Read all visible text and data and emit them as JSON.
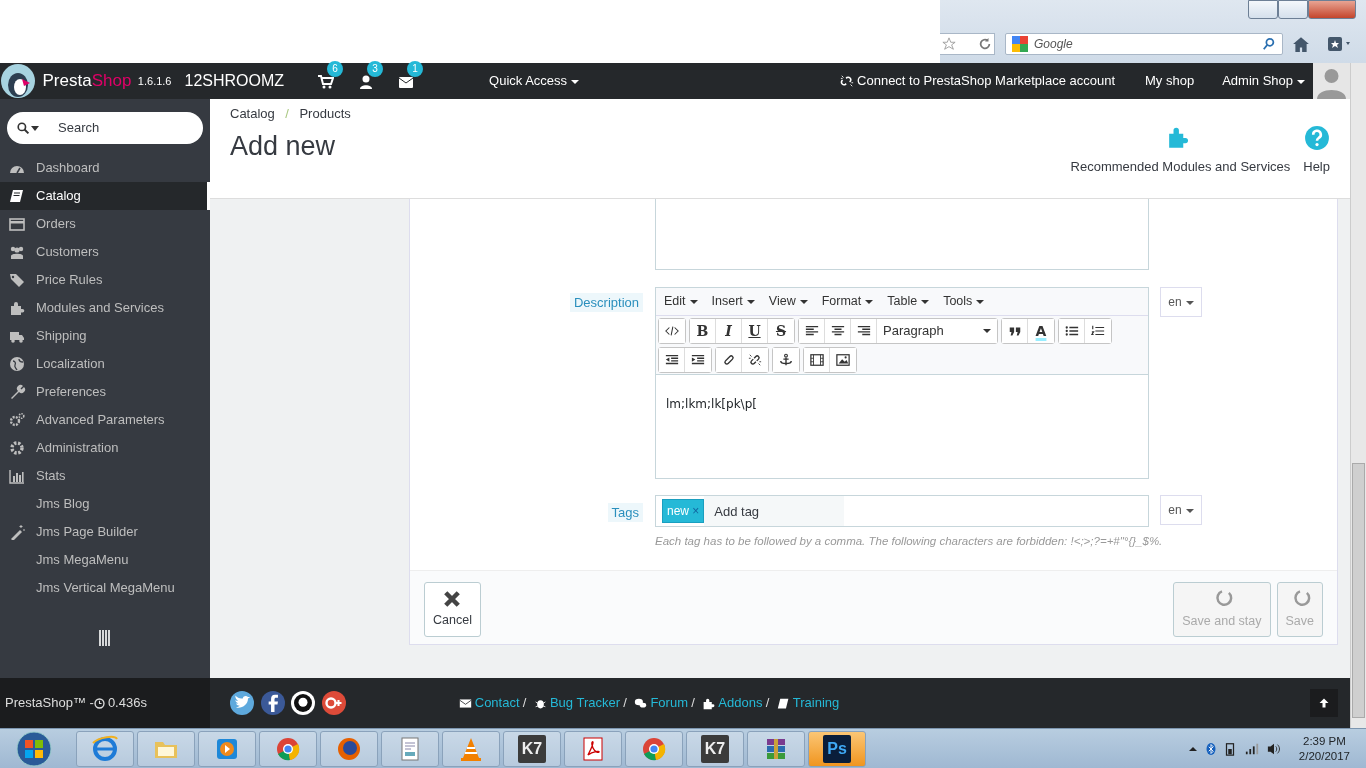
{
  "browser": {
    "search_placeholder": "Google"
  },
  "header": {
    "brand_first": "Presta",
    "brand_second": "Shop",
    "version": "1.6.1.6",
    "shop_name": "12SHROOMZ",
    "notifications": [
      {
        "kind": "cart",
        "count": "6"
      },
      {
        "kind": "user",
        "count": "3"
      },
      {
        "kind": "mail",
        "count": "1"
      }
    ],
    "quick_access": "Quick Access",
    "connect": "Connect to PrestaShop Marketplace account",
    "my_shop": "My shop",
    "admin": "Admin Shop"
  },
  "sidebar": {
    "search_placeholder": "Search",
    "items": [
      {
        "label": "Dashboard",
        "kind": "dashboard",
        "selected": false
      },
      {
        "label": "Catalog",
        "kind": "catalog",
        "selected": true
      },
      {
        "label": "Orders",
        "kind": "orders",
        "selected": false
      },
      {
        "label": "Customers",
        "kind": "customers",
        "selected": false
      },
      {
        "label": "Price Rules",
        "kind": "price",
        "selected": false
      },
      {
        "label": "Modules and Services",
        "kind": "modules",
        "selected": false
      },
      {
        "label": "Shipping",
        "kind": "shipping",
        "selected": false
      },
      {
        "label": "Localization",
        "kind": "localization",
        "selected": false
      },
      {
        "label": "Preferences",
        "kind": "preferences",
        "selected": false
      },
      {
        "label": "Advanced Parameters",
        "kind": "advanced",
        "selected": false
      },
      {
        "label": "Administration",
        "kind": "administration",
        "selected": false
      },
      {
        "label": "Stats",
        "kind": "stats",
        "selected": false
      },
      {
        "label": "Jms Blog",
        "kind": "none",
        "selected": false
      },
      {
        "label": "Jms Page Builder",
        "kind": "wand",
        "selected": false
      },
      {
        "label": "Jms MegaMenu",
        "kind": "none",
        "selected": false
      },
      {
        "label": "Jms Vertical MegaMenu",
        "kind": "none",
        "selected": false
      }
    ]
  },
  "page_head": {
    "breadcrumb": [
      "Catalog",
      "Products"
    ],
    "breadcrumb_separator": "/",
    "title": "Add new",
    "toolbar": [
      {
        "kind": "modules",
        "label": "Recommended Modules and Services"
      },
      {
        "kind": "help",
        "label": "Help"
      }
    ]
  },
  "form": {
    "description": {
      "label": "Description",
      "menus": [
        "Edit",
        "Insert",
        "View",
        "Format",
        "Table",
        "Tools"
      ],
      "toolbar_rows": [
        [
          [
            {
              "kind": "code"
            }
          ],
          [
            {
              "kind": "bold",
              "glyph": "B"
            },
            {
              "kind": "italic",
              "glyph": "I"
            },
            {
              "kind": "underline",
              "glyph": "U"
            },
            {
              "kind": "strike",
              "glyph": "S"
            }
          ],
          [
            {
              "kind": "alignleft"
            },
            {
              "kind": "aligncenter"
            },
            {
              "kind": "alignright"
            },
            {
              "kind": "select",
              "label": "Paragraph"
            }
          ],
          [
            {
              "kind": "quote"
            },
            {
              "kind": "color",
              "glyph": "A"
            }
          ],
          [
            {
              "kind": "bullist"
            },
            {
              "kind": "numlist"
            }
          ]
        ],
        [
          [
            {
              "kind": "outdent"
            },
            {
              "kind": "indent"
            }
          ],
          [
            {
              "kind": "link"
            },
            {
              "kind": "unlink"
            }
          ],
          [
            {
              "kind": "anchor"
            }
          ],
          [
            {
              "kind": "media"
            },
            {
              "kind": "image"
            }
          ]
        ]
      ],
      "content": "lm;lkm;lk[pk\\p[",
      "language": "en"
    },
    "tags": {
      "label": "Tags",
      "items": [
        {
          "label": "new",
          "remove": "×"
        }
      ],
      "placeholder": "Add tag",
      "language": "en",
      "hint": "Each tag has to be followed by a comma. The following characters are forbidden: !<;>;?=+#\"°{}_$%."
    },
    "buttons": [
      {
        "kind": "cancel",
        "label": "Cancel",
        "disabled": false
      },
      {
        "kind": "refresh",
        "label": "Save and stay",
        "disabled": true
      },
      {
        "kind": "refresh",
        "label": "Save",
        "disabled": true
      }
    ]
  },
  "footer": {
    "brand": "PrestaShop™ - ",
    "time": "0.436s",
    "social": [
      {
        "kind": "twitter"
      },
      {
        "kind": "facebook"
      },
      {
        "kind": "github"
      },
      {
        "kind": "googleplus"
      }
    ],
    "links": [
      {
        "kind": "mail",
        "label": "Contact"
      },
      {
        "kind": "bug",
        "label": "Bug Tracker"
      },
      {
        "kind": "forum",
        "label": "Forum"
      },
      {
        "kind": "puzzle",
        "label": "Addons"
      },
      {
        "kind": "book",
        "label": "Training"
      }
    ],
    "separator": "/"
  },
  "taskbar": {
    "apps": [
      {
        "kind": "ie"
      },
      {
        "kind": "folder"
      },
      {
        "kind": "media"
      },
      {
        "kind": "chrome"
      },
      {
        "kind": "firefox"
      },
      {
        "kind": "doc"
      },
      {
        "kind": "vlc"
      },
      {
        "kind": "k7",
        "glyph": "K7"
      },
      {
        "kind": "pdf"
      },
      {
        "kind": "chrome"
      },
      {
        "kind": "k7",
        "glyph": "K7"
      },
      {
        "kind": "rar"
      },
      {
        "kind": "ps",
        "glyph": "Ps"
      }
    ],
    "time": "2:39 PM",
    "date": "2/20/2017"
  }
}
